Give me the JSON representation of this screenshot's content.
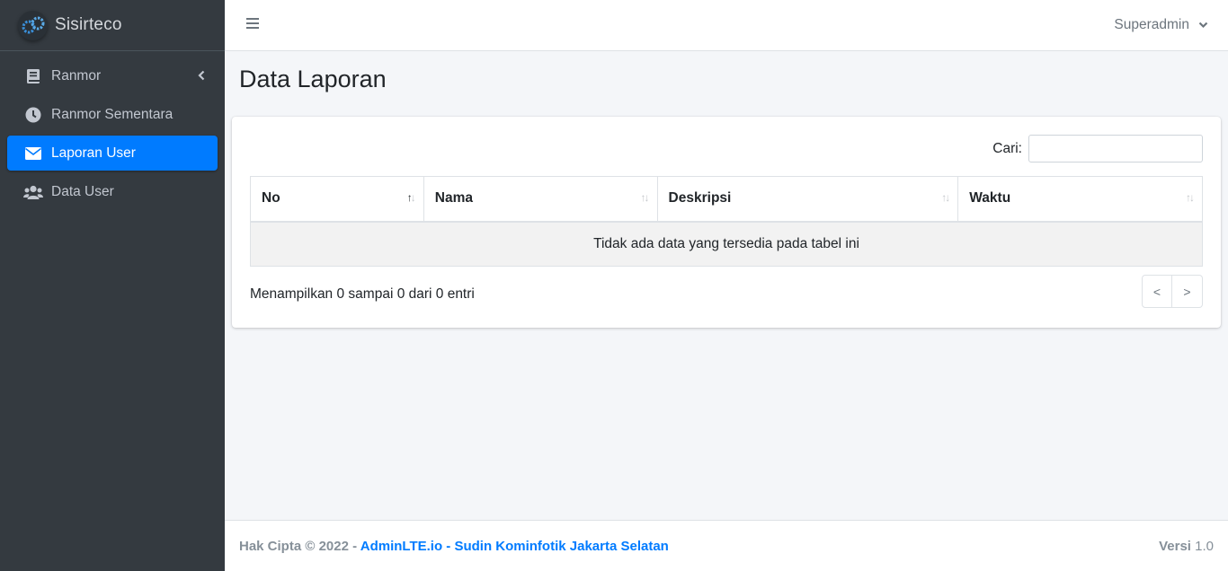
{
  "brand": {
    "name": "Sisirteco",
    "logo_icon": "gears-logo-icon"
  },
  "sidebar": {
    "items": [
      {
        "label": "Ranmor",
        "icon": "book-icon",
        "has_chevron": true
      },
      {
        "label": "Ranmor Sementara",
        "icon": "clock-icon"
      },
      {
        "label": "Laporan User",
        "icon": "envelope-icon",
        "active": true
      },
      {
        "label": "Data User",
        "icon": "users-icon"
      }
    ]
  },
  "topbar": {
    "menu_icon": "hamburger-icon",
    "user_name": "Superadmin"
  },
  "page": {
    "title": "Data Laporan"
  },
  "table": {
    "search_label": "Cari:",
    "search_value": "",
    "columns": [
      "No",
      "Nama",
      "Deskripsi",
      "Waktu"
    ],
    "sorted_column": "No",
    "sort_direction": "asc",
    "empty_message": "Tidak ada data yang tersedia pada tabel ini",
    "info": "Menampilkan 0 sampai 0 dari 0 entri",
    "pager": {
      "prev": "<",
      "next": ">"
    }
  },
  "footer": {
    "copyright": "Hak Cipta © 2022 -",
    "link_text": "AdminLTE.io - Sudin Kominfotik Jakarta Selatan",
    "version_label": "Versi",
    "version_value": "1.0"
  },
  "colors": {
    "sidebar_bg": "#343a40",
    "active_item": "#007bff",
    "link": "#007bff",
    "content_bg": "#f4f6f9"
  }
}
